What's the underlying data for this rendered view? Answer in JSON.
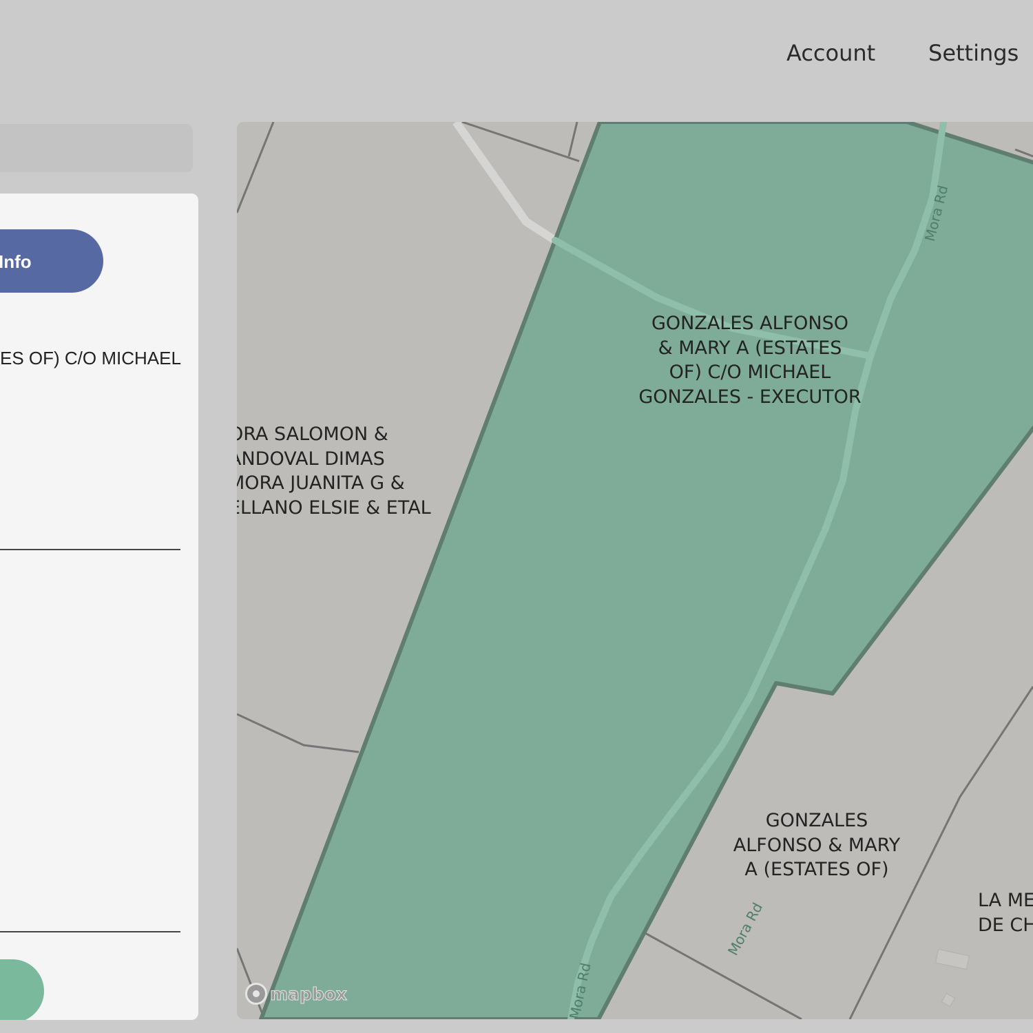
{
  "header": {
    "nav": [
      {
        "label": "Account"
      },
      {
        "label": "Settings"
      }
    ]
  },
  "panel": {
    "info_button_label": "Info",
    "owner_text": "ES OF) C/O MICHAEL"
  },
  "map": {
    "parcels": [
      {
        "label": "GONZALES ALFONSO\n& MARY A (ESTATES\nOF) C/O MICHAEL\nGONZALES - EXECUTOR"
      },
      {
        "label": "ORA SALOMON &\nANDOVAL DIMAS\nMORA JUANITA G &\nELLANO ELSIE & ETAL"
      },
      {
        "label": "GONZALES\nALFONSO & MARY\nA (ESTATES OF)"
      },
      {
        "label": "LA ME\nDE CH"
      }
    ],
    "roads": [
      {
        "label": "Mora Rd"
      },
      {
        "label": "Mora Rd"
      },
      {
        "label": "Mora Rd"
      }
    ],
    "attribution": "mapbox",
    "colors": {
      "parcel_selected_fill": "#7eac98",
      "parcel_selected_border": "#5f7d70",
      "parcel_fill": "#bdbcb8",
      "parcel_border": "#757575",
      "road": "#8fbfab"
    }
  },
  "colors": {
    "info_button": "#5669a2",
    "action_button": "#7ab99c",
    "background": "#cbcbcb",
    "panel": "#f5f5f5"
  }
}
